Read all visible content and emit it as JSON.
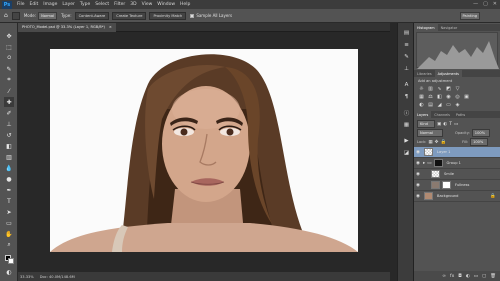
{
  "app": {
    "logo": "Ps"
  },
  "menubar": {
    "items": [
      "File",
      "Edit",
      "Image",
      "Layer",
      "Type",
      "Select",
      "Filter",
      "3D",
      "View",
      "Window",
      "Help"
    ],
    "window_controls": [
      "—",
      "▢",
      "✕"
    ]
  },
  "options_bar": {
    "mode_label": "Mode:",
    "mode_value": "Normal",
    "type_label": "Type:",
    "type_buttons": [
      "Proximity Match",
      "Create Texture",
      "Content-Aware"
    ],
    "sample_all_layers": "Sample All Layers",
    "workspace_value": "Painting"
  },
  "document": {
    "tab_title": "PHOTO_Model.psd @ 33.3% (Layer 1, RGB/8*)",
    "tab_close": "×"
  },
  "status": {
    "zoom": "33.33%",
    "doc_size": "Doc: 40.0M/148.6M"
  },
  "panels": {
    "histogram_tabs": [
      "Histogram",
      "Navigator"
    ],
    "adjust_tabs": [
      "Libraries",
      "Adjustments"
    ],
    "adjust_title": "Add an adjustment",
    "layer_tabs": [
      "Layers",
      "Channels",
      "Paths"
    ],
    "kind_label": "Kind",
    "blend_mode": "Normal",
    "opacity_label": "Opacity:",
    "opacity_value": "100%",
    "lock_label": "Lock:",
    "fill_label": "Fill:",
    "fill_value": "100%"
  },
  "layers": [
    {
      "name": "Layer 1",
      "selected": true,
      "mask": false
    },
    {
      "name": "Group 1",
      "selected": false,
      "mask": true,
      "folder": true
    },
    {
      "name": "Smile",
      "selected": false,
      "mask": false
    },
    {
      "name": "Fullness",
      "selected": false,
      "mask": true
    },
    {
      "name": "Background",
      "selected": false,
      "mask": false,
      "locked": true
    }
  ],
  "icons": {
    "eye": "eye-icon",
    "lock": "lock-icon",
    "folder": "folder-icon"
  },
  "colors": {
    "accent": "#31a8ff",
    "selected_layer": "#7e9bbf",
    "panel_bg": "#535353",
    "canvas_bg": "#282828"
  }
}
